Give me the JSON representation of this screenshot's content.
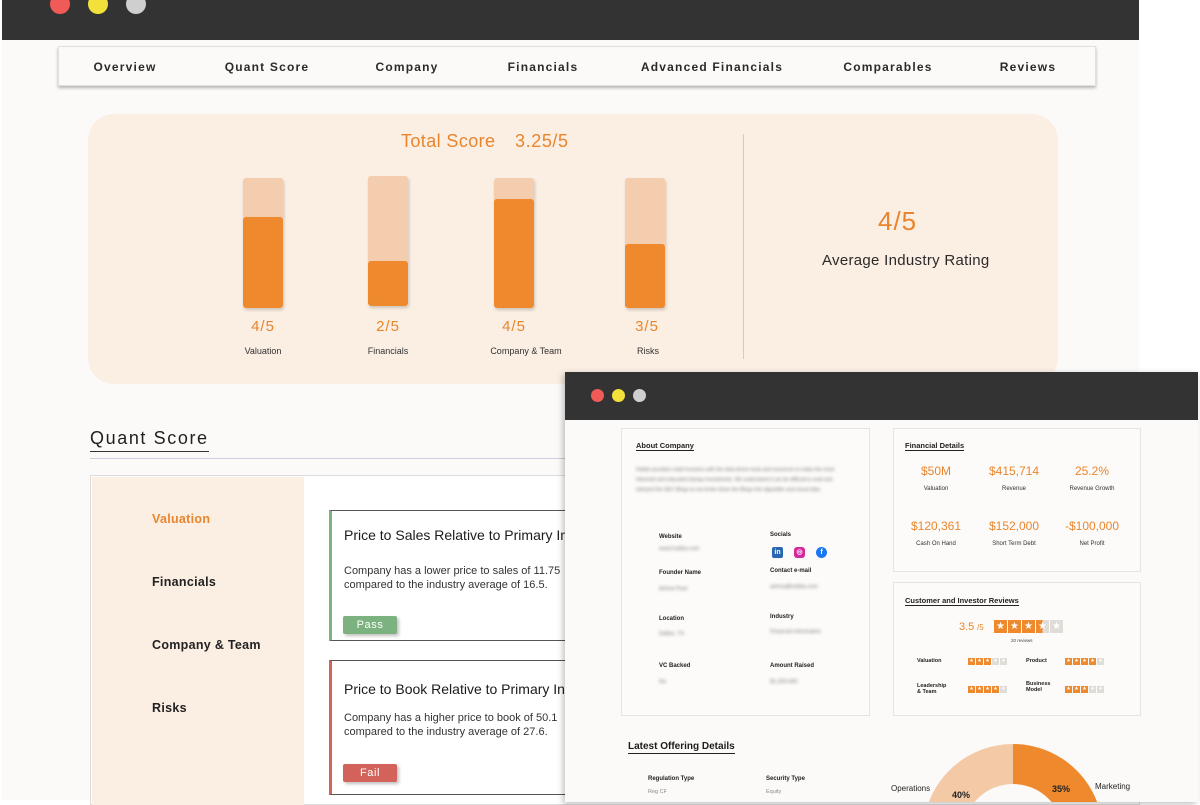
{
  "nav": {
    "items": [
      "Overview",
      "Quant Score",
      "Company",
      "Financials",
      "Advanced Financials",
      "Comparables",
      "Reviews"
    ]
  },
  "score": {
    "total_label": "Total Score",
    "total_value": "3.25/5",
    "bars": [
      {
        "value": "4/5",
        "label": "Valuation",
        "fill": 0.7
      },
      {
        "value": "2/5",
        "label": "Financials",
        "fill": 0.35
      },
      {
        "value": "4/5",
        "label": "Company & Team",
        "fill": 0.84
      },
      {
        "value": "3/5",
        "label": "Risks",
        "fill": 0.49
      }
    ],
    "avg_value": "4/5",
    "avg_label": "Average Industry Rating"
  },
  "quant": {
    "title": "Quant Score",
    "categories": [
      "Valuation",
      "Financials",
      "Company & Team",
      "Risks"
    ],
    "metrics": [
      {
        "title": "Price to Sales Relative to Primary Industry",
        "desc": "Company has a lower price to sales of 11.75 compared to the industry average of 16.5.",
        "status": "Pass"
      },
      {
        "title": "Price to Book Relative to Primary Industry",
        "desc": "Company has a higher price to book of 50.1 compared to the industry average of 27.6.",
        "status": "Fail"
      }
    ]
  },
  "about": {
    "title": "About Company",
    "text": "Hubbe provides retail investors with the data driven tools and resources to make the most informed and educated startup investments. We understand it can be difficult to read and interpret the SEC filings so we broke down the filings into digestible and visual data.",
    "website_label": "Website",
    "website_value": "www.hubba.com",
    "socials_label": "Socials",
    "founder_label": "Founder Name",
    "founder_value": "Ashna Paul",
    "contact_label": "Contact e-mail",
    "contact_value": "ashna@hubba.com",
    "location_label": "Location",
    "location_value": "Dallas, TX",
    "industry_label": "Industry",
    "industry_value": "Financial Information",
    "vc_label": "VC Backed",
    "vc_value": "No",
    "raised_label": "Amount Raised",
    "raised_value": "$1,200,000"
  },
  "financial": {
    "title": "Financial Details",
    "items": [
      {
        "value": "$50M",
        "label": "Valuation"
      },
      {
        "value": "$415,714",
        "label": "Revenue"
      },
      {
        "value": "25.2%",
        "label": "Revenue Growth"
      },
      {
        "value": "$120,361",
        "label": "Cash On Hand"
      },
      {
        "value": "$152,000",
        "label": "Short Term Debt"
      },
      {
        "value": "-$100,000",
        "label": "Net Profit"
      }
    ]
  },
  "reviews": {
    "title": "Customer and Investor Reviews",
    "rating": "3.5",
    "rating_suffix": "/5",
    "count": "20 reviews",
    "stars": 3.5,
    "sub": [
      {
        "label": "Valuation",
        "stars": 3
      },
      {
        "label": "Product",
        "stars": 4
      },
      {
        "label": "Leadership & Team",
        "stars": 4
      },
      {
        "label": "Business Model",
        "stars": 3
      }
    ]
  },
  "offering": {
    "title": "Latest Offering Details",
    "reg_label": "Regulation Type",
    "reg_value": "Reg CF",
    "sec_label": "Security Type",
    "sec_value": "Equity",
    "donut_label_left": "Operations",
    "donut_label_right": "Marketing",
    "pct_left": "40%",
    "pct_right": "35%"
  },
  "colors": {
    "accent": "#ee8a2d",
    "accent_light": "#f3cdad",
    "panel": "#fbeee3",
    "titlebar": "#333333",
    "pass": "#7cb27f",
    "fail": "#d2625a"
  }
}
